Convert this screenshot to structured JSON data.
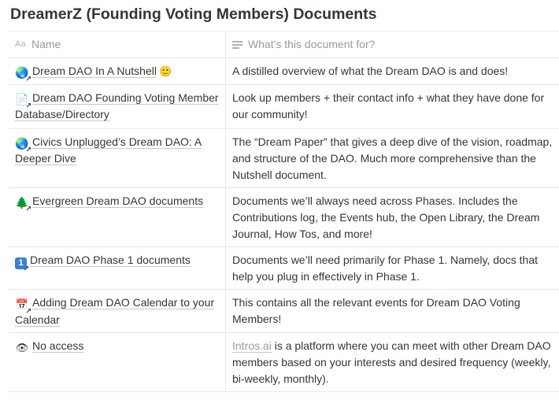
{
  "page": {
    "title": "DreamerZ (Founding Voting Members) Documents"
  },
  "table": {
    "headers": {
      "name": "Name",
      "purpose": "What's this document for?",
      "name_icon": "Aa",
      "purpose_icon": "text-lines-icon"
    },
    "rows": [
      {
        "icon": "🌏",
        "icon_name": "globe-icon",
        "name": "Dream DAO In A Nutshell",
        "trail": "🙂",
        "purpose": "A distilled overview of what the Dream DAO is and does!"
      },
      {
        "icon": "📄",
        "icon_name": "page-icon",
        "name": "Dream DAO Founding Voting Member Database/Directory",
        "purpose": "Look up members + their contact info + what they have done for our community!"
      },
      {
        "icon": "🌏",
        "icon_name": "globe-icon",
        "name": "Civics Unplugged’s Dream DAO: A Deeper Dive",
        "purpose": "The “Dream Paper” that gives a deep dive of the vision, roadmap, and structure of the DAO. Much more comprehensive than the Nutshell document."
      },
      {
        "icon": "🌲",
        "icon_name": "evergreen-tree-icon",
        "name": "Evergreen Dream DAO documents",
        "purpose": "Documents we’ll always need across Phases. Includes the Contributions log, the Events hub, the Open Library, the Dream Journal, How Tos, and more!"
      },
      {
        "icon": "1",
        "icon_name": "number-one-icon",
        "name": "Dream DAO Phase 1 documents",
        "purpose": "Documents we’ll need primarily for Phase 1. Namely, docs that help you plug in effectively in Phase 1."
      },
      {
        "icon": "📅",
        "icon_name": "calendar-icon",
        "name": "Adding Dream DAO Calendar to your Calendar",
        "purpose": "This contains all the relevant events for Dream DAO Voting Members!"
      },
      {
        "icon": "👁",
        "icon_name": "eye-icon",
        "name": "No access",
        "purpose_link": "Intros.ai",
        "purpose": " is a platform where you can meet with other Dream DAO members based on your interests and desired frequency (weekly, bi-weekly, monthly)."
      }
    ]
  },
  "colors": {
    "text": "#37352f",
    "muted": "#9b9a97",
    "border": "#e9e9e7"
  }
}
